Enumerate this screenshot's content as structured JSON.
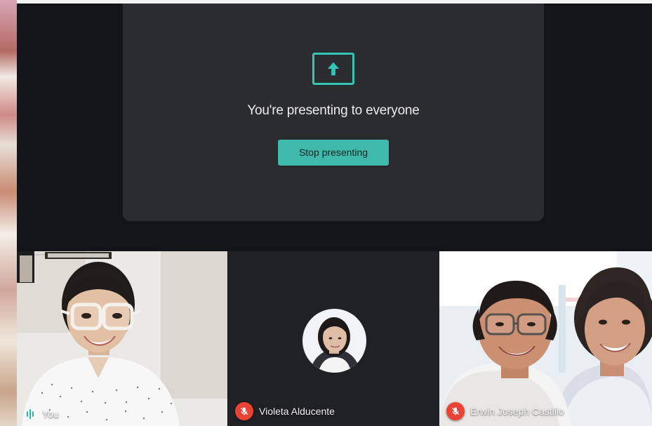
{
  "presentation": {
    "title": "You're presenting to everyone",
    "button_label": "Stop presenting",
    "icon": "present-to-all-icon"
  },
  "participants": [
    {
      "name": "You",
      "mic": "active",
      "icon": "audio-level-icon"
    },
    {
      "name": "Violeta Alducente",
      "mic": "muted",
      "icon": "mic-off-icon"
    },
    {
      "name": "Erwin Joseph Castillo",
      "mic": "muted",
      "icon": "mic-off-icon"
    }
  ],
  "colors": {
    "accent": "#3fb9ac",
    "muted_badge": "#ea4335",
    "stage_bg": "#2b2c30",
    "tiles_bg": "#202124"
  }
}
